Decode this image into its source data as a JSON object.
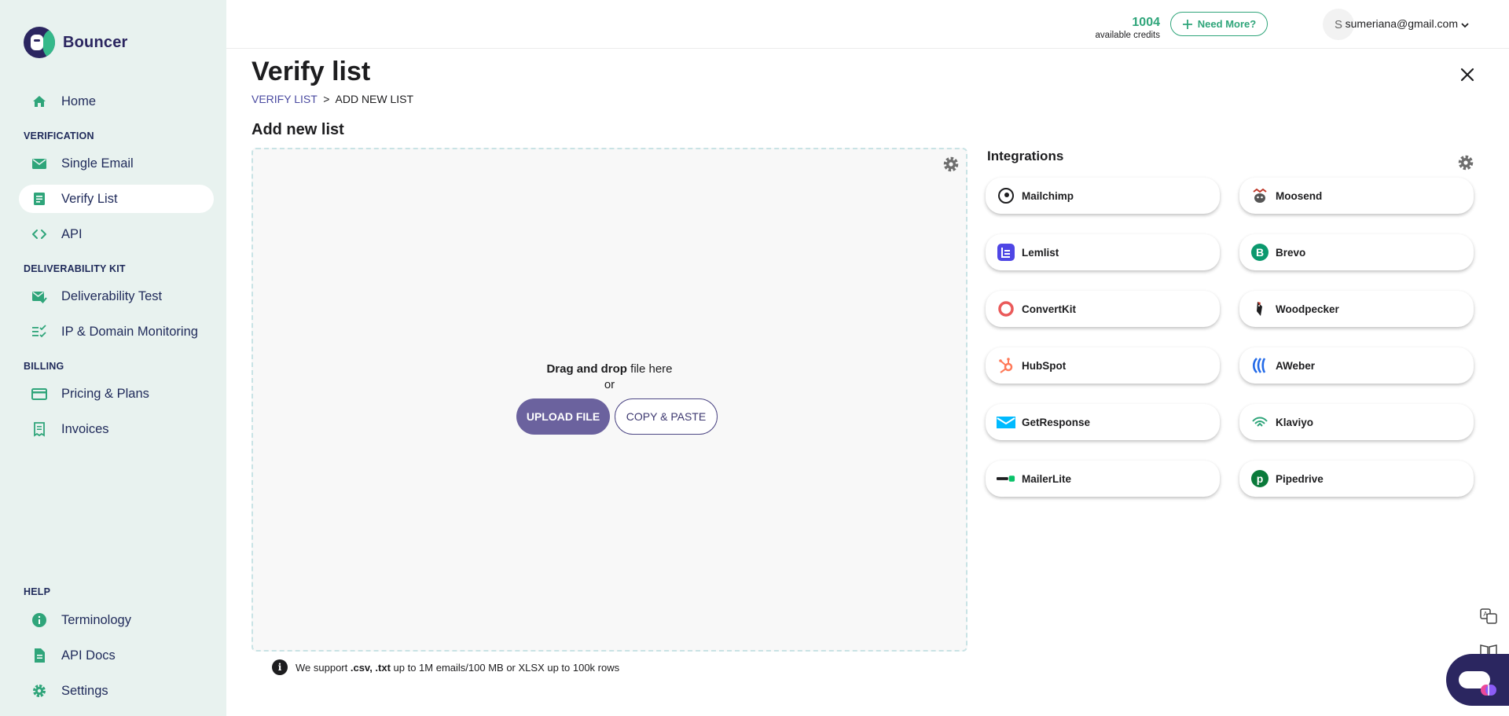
{
  "brand": {
    "name": "Bouncer"
  },
  "sidebar": {
    "items_top": [
      {
        "label": "Home",
        "icon": "home-icon"
      }
    ],
    "sections": [
      {
        "title": "VERIFICATION",
        "items": [
          {
            "label": "Single Email",
            "icon": "envelope-icon"
          },
          {
            "label": "Verify List",
            "icon": "list-document-icon",
            "active": true
          },
          {
            "label": "API",
            "icon": "code-icon"
          }
        ]
      },
      {
        "title": "DELIVERABILITY KIT",
        "items": [
          {
            "label": "Deliverability Test",
            "icon": "envelope-check-icon"
          },
          {
            "label": "IP & Domain Monitoring",
            "icon": "checklist-icon"
          }
        ]
      },
      {
        "title": "BILLING",
        "items": [
          {
            "label": "Pricing & Plans",
            "icon": "credit-card-icon"
          },
          {
            "label": "Invoices",
            "icon": "receipt-icon"
          }
        ]
      },
      {
        "title": "HELP",
        "items": [
          {
            "label": "Terminology",
            "icon": "info-icon"
          },
          {
            "label": "API Docs",
            "icon": "document-icon"
          },
          {
            "label": "Settings",
            "icon": "gear-icon"
          }
        ]
      }
    ]
  },
  "header": {
    "credits": "1004",
    "credits_caption": "available credits",
    "need_more_label": "Need More?",
    "avatar_initial": "S",
    "user_email": "sumeriana@gmail.com"
  },
  "main": {
    "title": "Verify list",
    "breadcrumb": {
      "parent": "VERIFY LIST",
      "separator": ">",
      "current": "ADD NEW LIST"
    },
    "section_title": "Add new list",
    "dropzone": {
      "drag_bold": "Drag and drop",
      "drag_rest": " file here",
      "or": "or",
      "upload_label": "UPLOAD FILE",
      "paste_label": "COPY & PASTE"
    },
    "support_note": {
      "prefix": "We support ",
      "formats": ".csv, .txt",
      "suffix": " up to 1M emails/100 MB or XLSX up to 100k rows"
    }
  },
  "integrations": {
    "title": "Integrations",
    "items": [
      {
        "name": "Mailchimp",
        "icon": "mailchimp-icon",
        "color": "#1d1d1f"
      },
      {
        "name": "Moosend",
        "icon": "moosend-icon",
        "color": "#c0392b"
      },
      {
        "name": "Lemlist",
        "icon": "lemlist-icon",
        "color": "#4f46e5"
      },
      {
        "name": "Brevo",
        "icon": "brevo-icon",
        "color": "#0b996e"
      },
      {
        "name": "ConvertKit",
        "icon": "convertkit-icon",
        "color": "#ea5a5a"
      },
      {
        "name": "Woodpecker",
        "icon": "woodpecker-icon",
        "color": "#c0392b"
      },
      {
        "name": "HubSpot",
        "icon": "hubspot-icon",
        "color": "#ff7a59"
      },
      {
        "name": "AWeber",
        "icon": "aweber-icon",
        "color": "#246be8"
      },
      {
        "name": "GetResponse",
        "icon": "getresponse-icon",
        "color": "#00baff"
      },
      {
        "name": "Klaviyo",
        "icon": "klaviyo-icon",
        "color": "#2fa57a"
      },
      {
        "name": "MailerLite",
        "icon": "mailerlite-icon",
        "color": "#09c269"
      },
      {
        "name": "Pipedrive",
        "icon": "pipedrive-icon",
        "color": "#0a7a3a"
      }
    ]
  },
  "colors": {
    "accent_green": "#2fa57a",
    "brand_purple": "#2b2660",
    "upload_purple": "#6b629e",
    "sidebar_bg": "#e8f2ef"
  }
}
